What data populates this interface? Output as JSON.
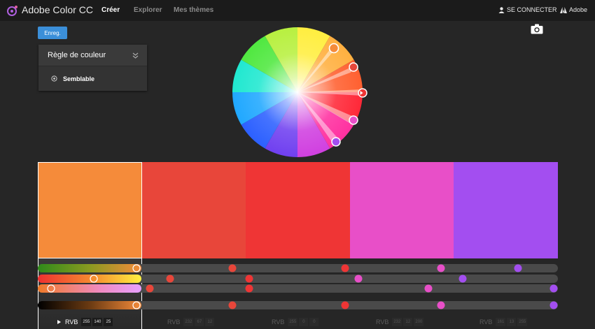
{
  "header": {
    "app_title": "Adobe Color CC",
    "nav": [
      {
        "label": "Créer",
        "active": true
      },
      {
        "label": "Explorer",
        "active": false
      },
      {
        "label": "Mes thèmes",
        "active": false
      }
    ],
    "login_label": "SE CONNECTER",
    "adobe_label": "Adobe",
    "icons": {
      "logo": "adobe-color-icon",
      "user": "user-icon",
      "adobe": "adobe-logo-icon"
    }
  },
  "toolbar": {
    "save_label": "Enreg.",
    "camera_icon": "camera-icon"
  },
  "rule_panel": {
    "title": "Règle de couleur",
    "collapse_icon": "chevron-double-down-icon",
    "selected_rule": "Semblable",
    "radio_icon": "radio-icon"
  },
  "accent_color": "#3b8fd9",
  "swatches": [
    {
      "hex": "#f58b3a",
      "selected": true,
      "mode": "RVB",
      "values": [
        "255",
        "140",
        "25"
      ]
    },
    {
      "hex": "#e8463a",
      "selected": false,
      "mode": "RVB",
      "values": [
        "232",
        "67",
        "12"
      ]
    },
    {
      "hex": "#ef3535",
      "selected": false,
      "mode": "RVB",
      "values": [
        "255",
        "0",
        "0"
      ]
    },
    {
      "hex": "#e84fc8",
      "selected": false,
      "mode": "RVB",
      "values": [
        "232",
        "12",
        "200"
      ]
    },
    {
      "hex": "#a34ef0",
      "selected": false,
      "mode": "RVB",
      "values": [
        "161",
        "13",
        "255"
      ]
    }
  ]
}
